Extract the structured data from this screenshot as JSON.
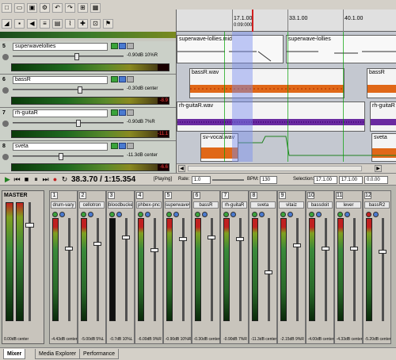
{
  "tracks": [
    {
      "num": "5",
      "name": "superwavelollies",
      "value": "-0.90dB 10%R",
      "peak": ""
    },
    {
      "num": "6",
      "name": "bassR",
      "value": "-0.30dB center",
      "peak": "-8.9"
    },
    {
      "num": "7",
      "name": "rh-guitaR",
      "value": "-0.90dB 7%R",
      "peak": "-11.1"
    },
    {
      "num": "8",
      "name": "sveta",
      "value": "-11.3dB center",
      "peak": "-6.6"
    }
  ],
  "ruler": {
    "labels": [
      "17.1.00",
      "33.1.00",
      "40.1.00"
    ],
    "sub": "0:09:000"
  },
  "clips": [
    {
      "name": "superwave-lollies.mid"
    },
    {
      "name": "superwave-lollies"
    },
    {
      "name": "bassR.wav"
    },
    {
      "name": "bassR"
    },
    {
      "name": "rh-guitaR.wav"
    },
    {
      "name": "rh-guitaR"
    },
    {
      "name": "sv-vocal.wav"
    },
    {
      "name": "sveta"
    }
  ],
  "transport": {
    "time": "38.3.70 / 1:15.354",
    "status": "[Playing]",
    "rate_label": "Rate:",
    "rate": "1.0",
    "bpm_label": "BPM:",
    "bpm": "130",
    "selection_label": "Selection:",
    "sel_start": "17.1.00",
    "sel_end": "17.1.00",
    "sel_len": "0.0.00"
  },
  "mixer": {
    "master_label": "MASTER",
    "master_value": "0.00dB center",
    "channels": [
      {
        "num": "1",
        "name": "drum-vary",
        "value": "-4.43dB center"
      },
      {
        "num": "2",
        "name": "cellotron",
        "value": "-5.00dB 5%L"
      },
      {
        "num": "3",
        "name": "bloodbucket",
        "value": "-0.7dB 10%L"
      },
      {
        "num": "4",
        "name": "phbex-pnc",
        "value": "-6.00dB 9%R"
      },
      {
        "num": "5",
        "name": "superwavev",
        "value": "-0.90dB 10%R"
      },
      {
        "num": "6",
        "name": "bassR",
        "value": "-0.30dB center"
      },
      {
        "num": "7",
        "name": "rh-guitaR",
        "value": "-0.90dB 7%R"
      },
      {
        "num": "8",
        "name": "sveta",
        "value": "-11.3dB center"
      },
      {
        "num": "9",
        "name": "vitaiz",
        "value": "-2.15dB 9%R"
      },
      {
        "num": "10",
        "name": "bassdoit",
        "value": "-4.00dB center"
      },
      {
        "num": "11",
        "name": "lever",
        "value": "-4.33dB center"
      },
      {
        "num": "12",
        "name": "bassR2",
        "value": "-5.20dB center"
      }
    ]
  },
  "tabs": [
    "Mixer",
    "Media Explorer",
    "Performance"
  ],
  "colors": {
    "accent": "#3aa33a",
    "clip_orange": "#e06818",
    "clip_purple": "#6a2aa0",
    "selection": "#7a8cf0"
  }
}
